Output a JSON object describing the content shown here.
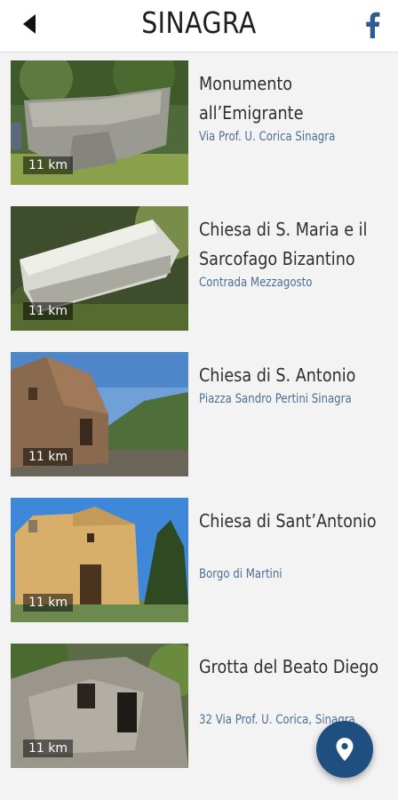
{
  "header": {
    "title": "SINAGRA",
    "back_icon": "back-arrow-icon",
    "social_icon": "facebook-icon"
  },
  "places": [
    {
      "name": "Monumento all’Emigrante",
      "address": "Via Prof. U. Corica Sinagra",
      "distance": "11 km"
    },
    {
      "name": "Chiesa di S. Maria e il Sarcofago Bizantino",
      "address": "Contrada Mezzagosto",
      "distance": "11 km"
    },
    {
      "name": "Chiesa di S. Antonio",
      "address": "Piazza Sandro Pertini Sinagra",
      "distance": "11 km"
    },
    {
      "name": "Chiesa di Sant’Antonio",
      "address": "Borgo di Martini",
      "distance": "11 km"
    },
    {
      "name": "Grotta del Beato Diego",
      "address": "32 Via Prof. U. Corica, Sinagra",
      "distance": "11 km"
    }
  ],
  "fab": {
    "icon": "map-pin-icon"
  },
  "colors": {
    "accent": "#1f4f80",
    "address_text": "#4d6f96",
    "facebook": "#2f5b95"
  }
}
